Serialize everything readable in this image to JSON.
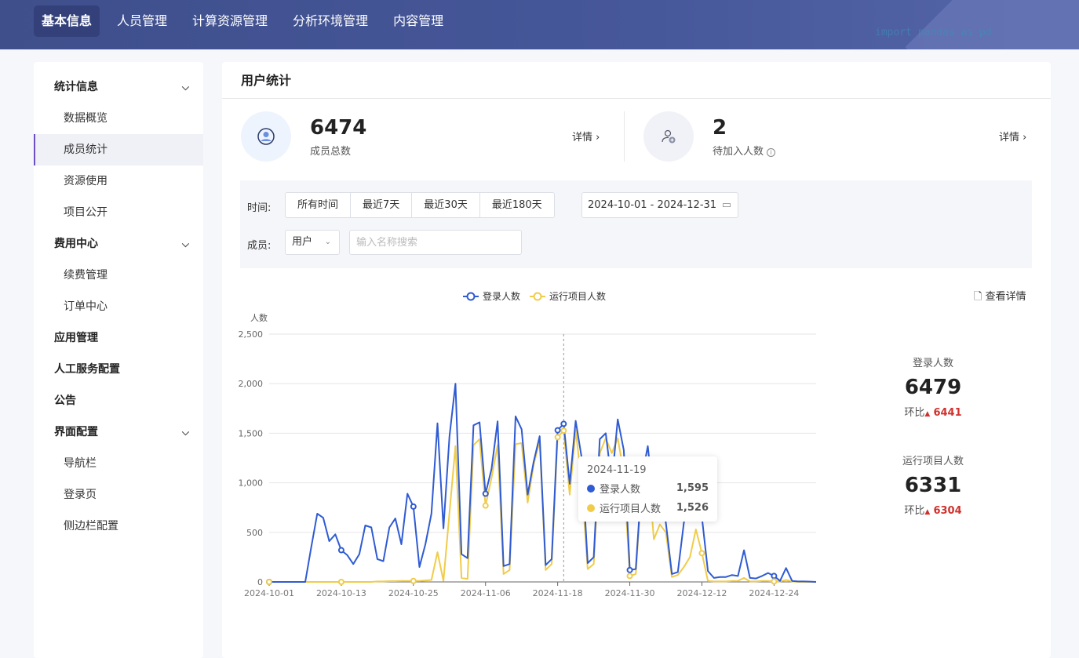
{
  "topnav": {
    "items": [
      "基本信息",
      "人员管理",
      "计算资源管理",
      "分析环境管理",
      "内容管理"
    ],
    "active": 0,
    "banner_code": "import pandas as pd"
  },
  "sidebar": {
    "items": [
      {
        "label": "统计信息",
        "type": "group",
        "expandable": true
      },
      {
        "label": "数据概览",
        "type": "sub"
      },
      {
        "label": "成员统计",
        "type": "sub",
        "active": true
      },
      {
        "label": "资源使用",
        "type": "sub"
      },
      {
        "label": "项目公开",
        "type": "sub"
      },
      {
        "label": "费用中心",
        "type": "group",
        "expandable": true
      },
      {
        "label": "续费管理",
        "type": "sub"
      },
      {
        "label": "订单中心",
        "type": "sub"
      },
      {
        "label": "应用管理",
        "type": "group"
      },
      {
        "label": "人工服务配置",
        "type": "group"
      },
      {
        "label": "公告",
        "type": "group"
      },
      {
        "label": "界面配置",
        "type": "group",
        "expandable": true
      },
      {
        "label": "导航栏",
        "type": "sub"
      },
      {
        "label": "登录页",
        "type": "sub"
      },
      {
        "label": "侧边栏配置",
        "type": "sub"
      }
    ]
  },
  "main": {
    "title": "用户统计",
    "stats": [
      {
        "value": "6474",
        "label": "成员总数",
        "detail": "详情 ›"
      },
      {
        "value": "2",
        "label": "待加入人数",
        "detail": "详情 ›"
      }
    ],
    "filter": {
      "time_label": "时间:",
      "ranges": [
        "所有时间",
        "最近7天",
        "最近30天",
        "最近180天"
      ],
      "date_range": "2024-10-01 - 2024-12-31",
      "member_label": "成员:",
      "member_type": "用户",
      "search_placeholder": "输入名称搜索"
    },
    "view_details": "查看详情",
    "kpis": [
      {
        "title": "登录人数",
        "value": "6479",
        "ratio_label": "环比",
        "ratio_value": "6441"
      },
      {
        "title": "运行项目人数",
        "value": "6331",
        "ratio_label": "环比",
        "ratio_value": "6304"
      }
    ]
  },
  "chart_data": {
    "type": "line",
    "ylabel": "人数",
    "ylim": [
      0,
      2500
    ],
    "y_ticks": [
      "0",
      "500",
      "1,000",
      "1,500",
      "2,000",
      "2,500"
    ],
    "x_start": "2024-10-01",
    "x_end": "2024-12-31",
    "x_tick_labels": [
      "2024-10-01",
      "2024-10-13",
      "2024-10-25",
      "2024-11-06",
      "2024-11-18",
      "2024-11-30",
      "2024-12-12",
      "2024-12-24"
    ],
    "grid": true,
    "legend_position": "top-center",
    "series": [
      {
        "name": "登录人数",
        "color": "#2f5bd3",
        "values": [
          0,
          0,
          0,
          0,
          0,
          0,
          0,
          350,
          688,
          647,
          411,
          480,
          320,
          270,
          180,
          280,
          570,
          550,
          230,
          210,
          550,
          640,
          380,
          890,
          760,
          150,
          380,
          690,
          1600,
          540,
          1470,
          2000,
          280,
          240,
          1580,
          1610,
          890,
          1140,
          1620,
          160,
          180,
          1670,
          1540,
          880,
          1210,
          1470,
          170,
          230,
          1530,
          1595,
          990,
          1625,
          1250,
          190,
          250,
          1440,
          1500,
          1000,
          1640,
          1330,
          120,
          130,
          1050,
          1370,
          800,
          800,
          600,
          80,
          100,
          600,
          850,
          900,
          650,
          110,
          40,
          50,
          50,
          70,
          60,
          320,
          40,
          35,
          60,
          90,
          60,
          10,
          140,
          10,
          5,
          5,
          3,
          0
        ]
      },
      {
        "name": "运行项目人数",
        "color": "#f0cc4a",
        "values": [
          0,
          0,
          0,
          0,
          0,
          0,
          0,
          0,
          0,
          0,
          0,
          0,
          0,
          0,
          0,
          0,
          0,
          0,
          5,
          5,
          8,
          8,
          10,
          10,
          10,
          10,
          15,
          20,
          300,
          10,
          700,
          1370,
          40,
          30,
          1380,
          1440,
          770,
          1050,
          1380,
          80,
          120,
          1390,
          1400,
          800,
          1180,
          1420,
          120,
          180,
          1460,
          1526,
          880,
          1530,
          1000,
          130,
          180,
          1300,
          1450,
          1300,
          1450,
          1100,
          60,
          80,
          1000,
          1200,
          430,
          580,
          500,
          50,
          70,
          150,
          250,
          530,
          290,
          10,
          5,
          5,
          5,
          10,
          10,
          40,
          5,
          5,
          10,
          10,
          5,
          5,
          20,
          5,
          0,
          0,
          0,
          0
        ]
      }
    ],
    "tooltip": {
      "date": "2024-11-19",
      "rows": [
        {
          "name": "登录人数",
          "value": "1,595"
        },
        {
          "name": "运行项目人数",
          "value": "1,526"
        }
      ]
    }
  }
}
